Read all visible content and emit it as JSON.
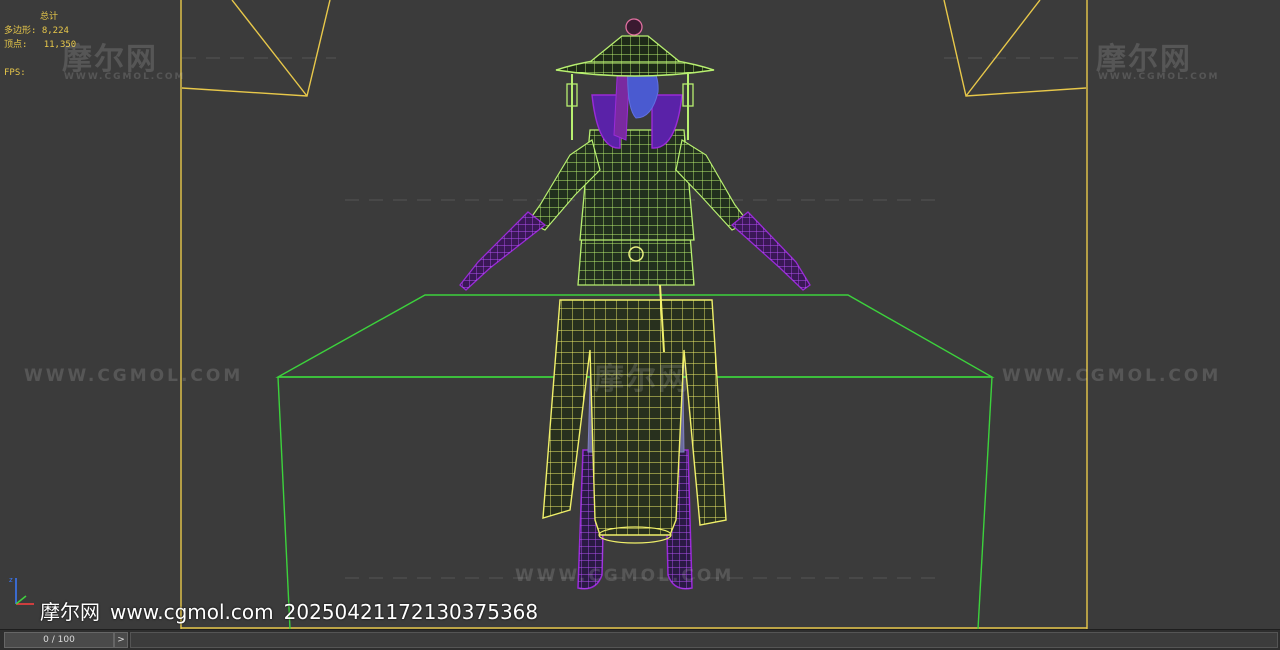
{
  "stats": {
    "title": "总计",
    "polygons_label": "多边形:",
    "polygons_value": "8,224",
    "vertices_label": "顶点:",
    "vertices_value": "11,350",
    "fps_label": "FPS:"
  },
  "watermarks": {
    "logo": "摩尔网",
    "sub": "WWW.CGMOL.COM",
    "url": "WWW.CGMOL.COM"
  },
  "caption": {
    "site_name": "摩尔网",
    "site_url": "www.cgmol.com",
    "image_id": "20250421172130375368"
  },
  "timeline": {
    "frame": "0 / 100",
    "next_label": ">"
  },
  "colors": {
    "viewport_bg": "#3b3b3b",
    "frame_yellow": "#e8c84a",
    "box_green": "#3cd23c",
    "wire_green": "#b8f070",
    "wire_yellow": "#f0f06a",
    "wire_purple": "#9a2ad8",
    "skin_blue": "#5060d0"
  }
}
